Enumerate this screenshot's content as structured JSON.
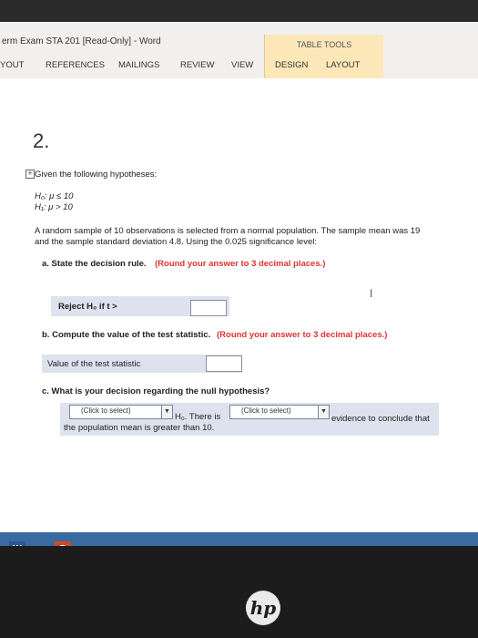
{
  "window": {
    "title": "erm Exam STA 201 [Read-Only] - Word"
  },
  "ribbon": {
    "table_tools": "TABLE TOOLS",
    "tabs": [
      "YOUT",
      "REFERENCES",
      "MAILINGS",
      "REVIEW",
      "VIEW",
      "DESIGN",
      "LAYOUT"
    ]
  },
  "document": {
    "question_number": "2.",
    "intro": "Given the following hypotheses:",
    "h0": "H₀: μ ≤ 10",
    "h1": "H₁: μ > 10",
    "paragraph_line1": "A random sample of 10 observations is selected from a normal population. The sample mean was 19",
    "paragraph_line2": "and the sample standard deviation 4.8. Using the 0.025 significance level:",
    "part_a": {
      "label": "a. State the decision rule.",
      "note": "(Round your answer to 3 decimal places.)",
      "reject_label": "Reject H₀ if t >",
      "answer_value": ""
    },
    "part_b": {
      "label": "b. Compute the value of the test statistic.",
      "note": "(Round your answer to 3 decimal places.)",
      "value_label": "Value of the test statistic",
      "answer_value": ""
    },
    "part_c": {
      "label": "c. What is your decision regarding the null hypothesis?",
      "select1_value": "(Click to select)",
      "h0_there_is": "H₀. There is",
      "select2_value": "(Click to select)",
      "evidence_text": "evidence to conclude that",
      "conclusion_line": "the population mean is greater than 10."
    }
  },
  "taskbar": {
    "word_icon": "W",
    "ppt_icon": "P"
  },
  "brand": {
    "logo": "hp"
  },
  "colors": {
    "accent_red": "#d33333",
    "table_tools_bg": "#fbe7b8",
    "answer_shade": "#dde2ee",
    "taskbar": "#3a6ba0"
  }
}
